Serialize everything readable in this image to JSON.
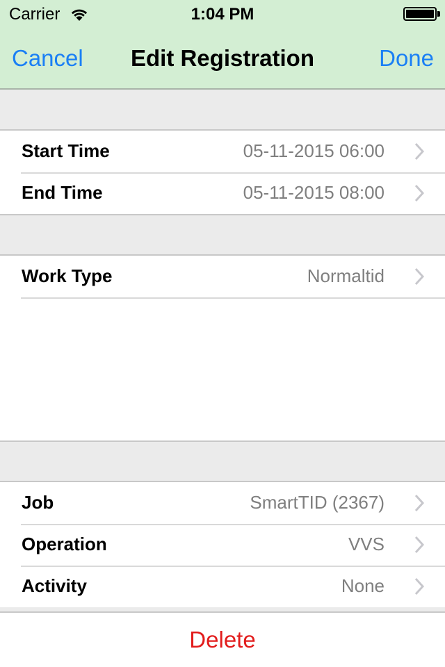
{
  "status_bar": {
    "carrier": "Carrier",
    "time": "1:04 PM",
    "wifi_icon": "wifi-icon",
    "battery_icon": "battery-full-icon"
  },
  "nav_bar": {
    "title": "Edit Registration",
    "cancel_label": "Cancel",
    "done_label": "Done"
  },
  "groups": [
    {
      "rows": [
        {
          "label": "Start Time",
          "value": "05-11-2015 06:00",
          "icon": "chevron-right-icon"
        },
        {
          "label": "End Time",
          "value": "05-11-2015 08:00",
          "icon": "chevron-right-icon"
        }
      ]
    },
    {
      "rows": [
        {
          "label": "Work Type",
          "value": "Normaltid",
          "icon": "chevron-right-icon"
        }
      ]
    },
    {
      "rows": [
        {
          "label": "Job",
          "value": "SmartTID (2367)",
          "icon": "chevron-right-icon"
        },
        {
          "label": "Operation",
          "value": "VVS",
          "icon": "chevron-right-icon"
        },
        {
          "label": "Activity",
          "value": "None",
          "icon": "chevron-right-icon"
        }
      ]
    }
  ],
  "delete_label": "Delete",
  "colors": {
    "header_bg": "#d3eed3",
    "accent": "#1a7ff5",
    "destructive": "#e21c1c",
    "value_text": "#7f7f7f",
    "background": "#ebebeb"
  }
}
